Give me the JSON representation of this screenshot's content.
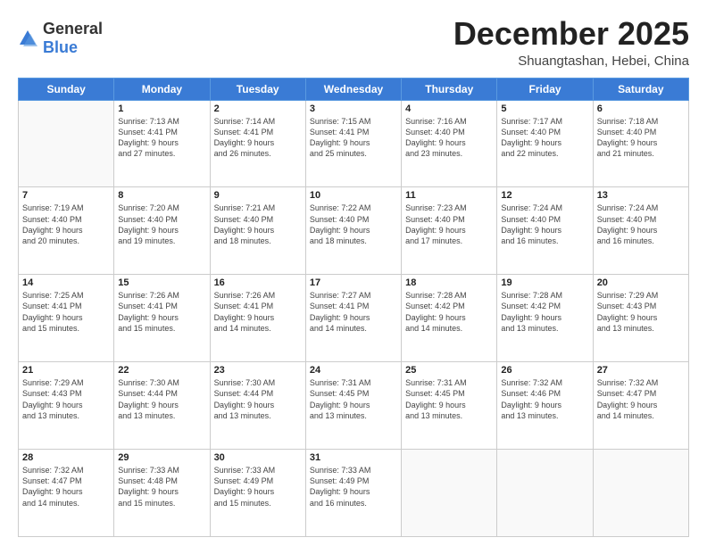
{
  "header": {
    "logo_general": "General",
    "logo_blue": "Blue",
    "month": "December 2025",
    "location": "Shuangtashan, Hebei, China"
  },
  "weekdays": [
    "Sunday",
    "Monday",
    "Tuesday",
    "Wednesday",
    "Thursday",
    "Friday",
    "Saturday"
  ],
  "weeks": [
    [
      {
        "day": "",
        "info": ""
      },
      {
        "day": "1",
        "info": "Sunrise: 7:13 AM\nSunset: 4:41 PM\nDaylight: 9 hours\nand 27 minutes."
      },
      {
        "day": "2",
        "info": "Sunrise: 7:14 AM\nSunset: 4:41 PM\nDaylight: 9 hours\nand 26 minutes."
      },
      {
        "day": "3",
        "info": "Sunrise: 7:15 AM\nSunset: 4:41 PM\nDaylight: 9 hours\nand 25 minutes."
      },
      {
        "day": "4",
        "info": "Sunrise: 7:16 AM\nSunset: 4:40 PM\nDaylight: 9 hours\nand 23 minutes."
      },
      {
        "day": "5",
        "info": "Sunrise: 7:17 AM\nSunset: 4:40 PM\nDaylight: 9 hours\nand 22 minutes."
      },
      {
        "day": "6",
        "info": "Sunrise: 7:18 AM\nSunset: 4:40 PM\nDaylight: 9 hours\nand 21 minutes."
      }
    ],
    [
      {
        "day": "7",
        "info": "Sunrise: 7:19 AM\nSunset: 4:40 PM\nDaylight: 9 hours\nand 20 minutes."
      },
      {
        "day": "8",
        "info": "Sunrise: 7:20 AM\nSunset: 4:40 PM\nDaylight: 9 hours\nand 19 minutes."
      },
      {
        "day": "9",
        "info": "Sunrise: 7:21 AM\nSunset: 4:40 PM\nDaylight: 9 hours\nand 18 minutes."
      },
      {
        "day": "10",
        "info": "Sunrise: 7:22 AM\nSunset: 4:40 PM\nDaylight: 9 hours\nand 18 minutes."
      },
      {
        "day": "11",
        "info": "Sunrise: 7:23 AM\nSunset: 4:40 PM\nDaylight: 9 hours\nand 17 minutes."
      },
      {
        "day": "12",
        "info": "Sunrise: 7:24 AM\nSunset: 4:40 PM\nDaylight: 9 hours\nand 16 minutes."
      },
      {
        "day": "13",
        "info": "Sunrise: 7:24 AM\nSunset: 4:40 PM\nDaylight: 9 hours\nand 16 minutes."
      }
    ],
    [
      {
        "day": "14",
        "info": "Sunrise: 7:25 AM\nSunset: 4:41 PM\nDaylight: 9 hours\nand 15 minutes."
      },
      {
        "day": "15",
        "info": "Sunrise: 7:26 AM\nSunset: 4:41 PM\nDaylight: 9 hours\nand 15 minutes."
      },
      {
        "day": "16",
        "info": "Sunrise: 7:26 AM\nSunset: 4:41 PM\nDaylight: 9 hours\nand 14 minutes."
      },
      {
        "day": "17",
        "info": "Sunrise: 7:27 AM\nSunset: 4:41 PM\nDaylight: 9 hours\nand 14 minutes."
      },
      {
        "day": "18",
        "info": "Sunrise: 7:28 AM\nSunset: 4:42 PM\nDaylight: 9 hours\nand 14 minutes."
      },
      {
        "day": "19",
        "info": "Sunrise: 7:28 AM\nSunset: 4:42 PM\nDaylight: 9 hours\nand 13 minutes."
      },
      {
        "day": "20",
        "info": "Sunrise: 7:29 AM\nSunset: 4:43 PM\nDaylight: 9 hours\nand 13 minutes."
      }
    ],
    [
      {
        "day": "21",
        "info": "Sunrise: 7:29 AM\nSunset: 4:43 PM\nDaylight: 9 hours\nand 13 minutes."
      },
      {
        "day": "22",
        "info": "Sunrise: 7:30 AM\nSunset: 4:44 PM\nDaylight: 9 hours\nand 13 minutes."
      },
      {
        "day": "23",
        "info": "Sunrise: 7:30 AM\nSunset: 4:44 PM\nDaylight: 9 hours\nand 13 minutes."
      },
      {
        "day": "24",
        "info": "Sunrise: 7:31 AM\nSunset: 4:45 PM\nDaylight: 9 hours\nand 13 minutes."
      },
      {
        "day": "25",
        "info": "Sunrise: 7:31 AM\nSunset: 4:45 PM\nDaylight: 9 hours\nand 13 minutes."
      },
      {
        "day": "26",
        "info": "Sunrise: 7:32 AM\nSunset: 4:46 PM\nDaylight: 9 hours\nand 13 minutes."
      },
      {
        "day": "27",
        "info": "Sunrise: 7:32 AM\nSunset: 4:47 PM\nDaylight: 9 hours\nand 14 minutes."
      }
    ],
    [
      {
        "day": "28",
        "info": "Sunrise: 7:32 AM\nSunset: 4:47 PM\nDaylight: 9 hours\nand 14 minutes."
      },
      {
        "day": "29",
        "info": "Sunrise: 7:33 AM\nSunset: 4:48 PM\nDaylight: 9 hours\nand 15 minutes."
      },
      {
        "day": "30",
        "info": "Sunrise: 7:33 AM\nSunset: 4:49 PM\nDaylight: 9 hours\nand 15 minutes."
      },
      {
        "day": "31",
        "info": "Sunrise: 7:33 AM\nSunset: 4:49 PM\nDaylight: 9 hours\nand 16 minutes."
      },
      {
        "day": "",
        "info": ""
      },
      {
        "day": "",
        "info": ""
      },
      {
        "day": "",
        "info": ""
      }
    ]
  ]
}
